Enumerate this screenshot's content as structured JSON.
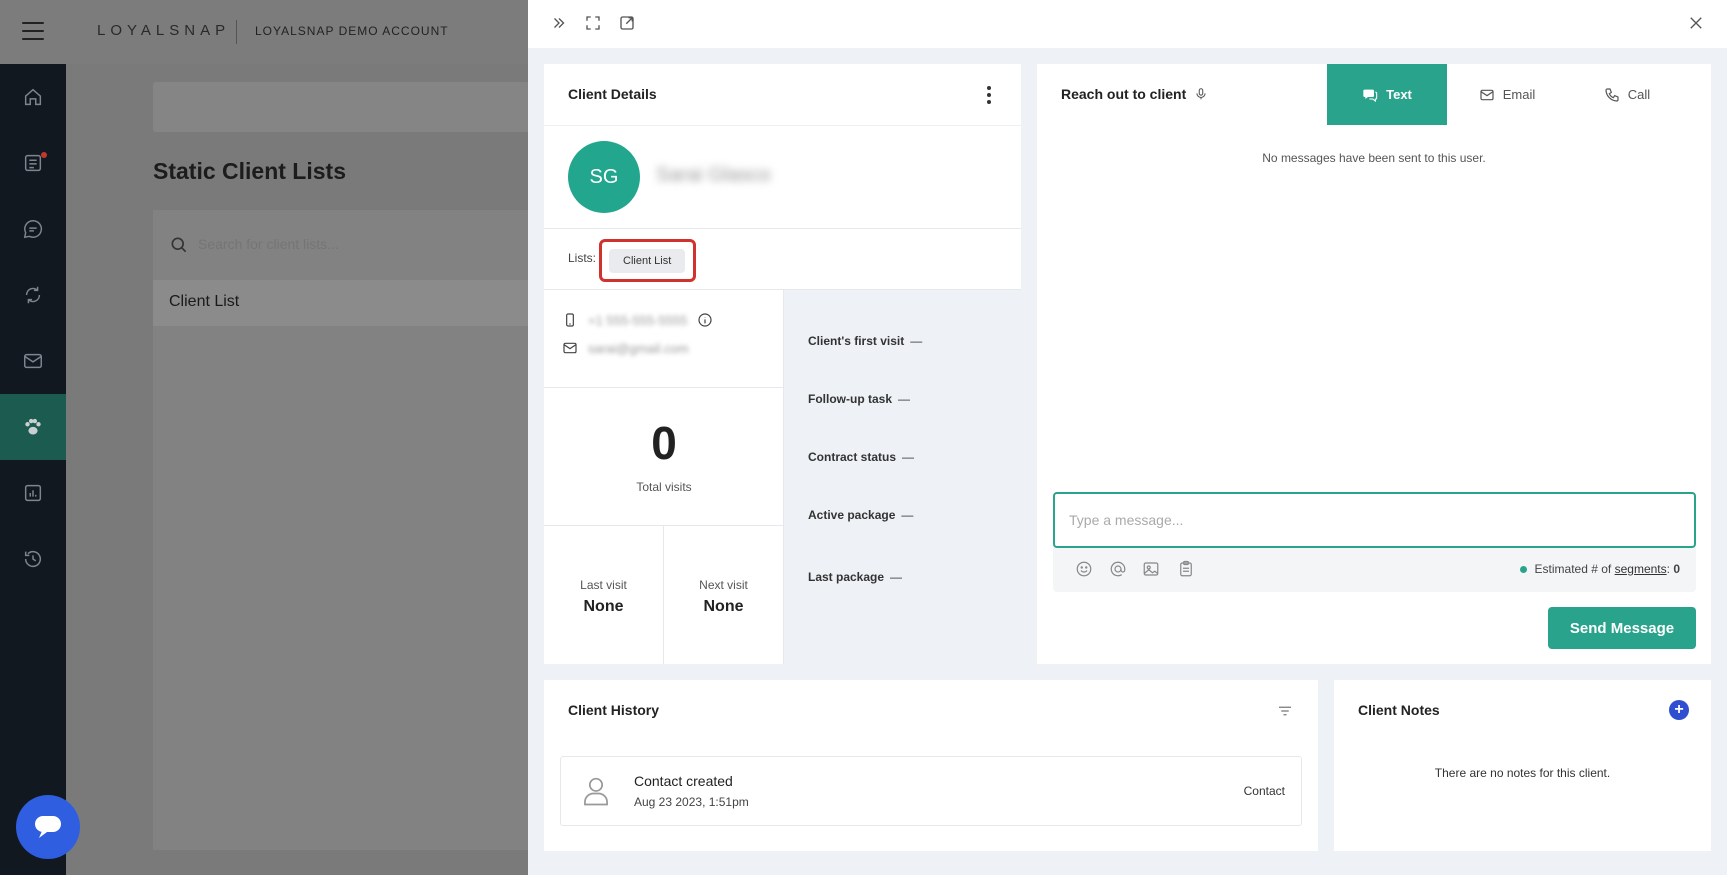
{
  "app": {
    "brand": "LOYALSNAP",
    "account": "LOYALSNAP DEMO ACCOUNT"
  },
  "background": {
    "page_title": "Static Client Lists",
    "search_placeholder": "Search for client lists...",
    "list_rows": [
      "Client List"
    ]
  },
  "client_details": {
    "title": "Client Details",
    "initials": "SG",
    "name": "Sarai Glasco",
    "lists_label": "Lists:",
    "list_chip": "Client List",
    "phone": "+1 555-555-5555",
    "email": "sarai@gmail.com",
    "total_visits_value": "0",
    "total_visits_label": "Total visits",
    "last_visit_label": "Last visit",
    "last_visit_value": "None",
    "next_visit_label": "Next visit",
    "next_visit_value": "None",
    "info": [
      {
        "label": "Client's first visit",
        "value": "—"
      },
      {
        "label": "Follow-up task",
        "value": "—"
      },
      {
        "label": "Contract status",
        "value": "—"
      },
      {
        "label": "Active package",
        "value": "—"
      },
      {
        "label": "Last package",
        "value": "—"
      }
    ]
  },
  "reach_out": {
    "title": "Reach out to client",
    "tabs": [
      {
        "label": "Text",
        "icon": "chat-icon",
        "active": true
      },
      {
        "label": "Email",
        "icon": "mail-icon",
        "active": false
      },
      {
        "label": "Call",
        "icon": "phone-icon",
        "active": false
      }
    ],
    "empty_text": "No messages have been sent to this user.",
    "message_placeholder": "Type a message...",
    "segments_prefix": "Estimated # of",
    "segments_link": "segments",
    "segments_value": "0",
    "send_label": "Send Message"
  },
  "client_history": {
    "title": "Client History",
    "items": [
      {
        "title": "Contact created",
        "date": "Aug 23 2023, 1:51pm",
        "type": "Contact"
      }
    ]
  },
  "client_notes": {
    "title": "Client Notes",
    "empty_text": "There are no notes for this client."
  },
  "colors": {
    "accent": "#2aa38c",
    "sidebar": "#12181f",
    "sidebar_active": "#1c5c50",
    "highlight": "#d0322d",
    "chat_bubble": "#2f5fe0"
  }
}
